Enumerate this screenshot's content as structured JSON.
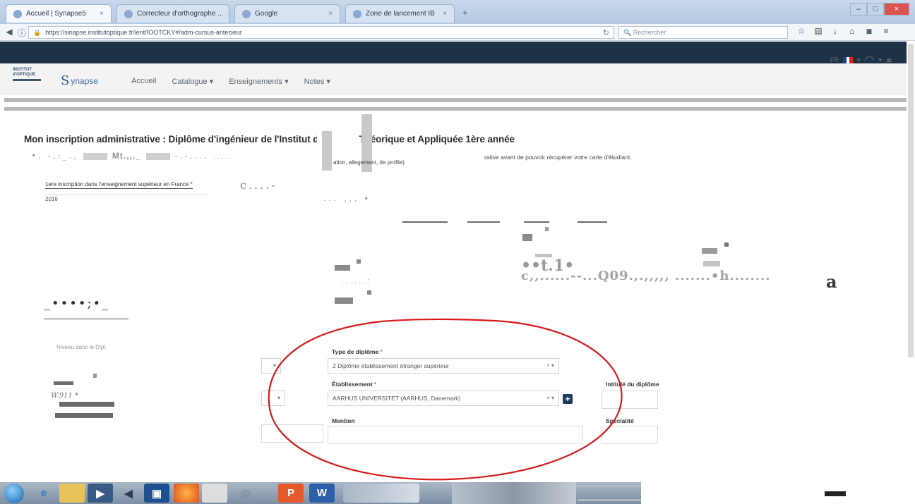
{
  "browser": {
    "tabs": [
      {
        "label": "Accueil | Synapse5"
      },
      {
        "label": "Correcteur d'orthographe ..."
      },
      {
        "label": "Google"
      },
      {
        "label": "Zone de lancement IB"
      }
    ],
    "new_tab_label": "+",
    "url": "https://sinapse.institutoptique.fr/ient/IOOTCKY#/adm-cursus-antecieur",
    "search_placeholder": "Rechercher",
    "toolbar_icons": [
      "star-icon",
      "bookmark-icon",
      "download-icon",
      "home-icon",
      "pocket-icon",
      "menu-icon"
    ]
  },
  "site": {
    "logo_text_1": "INSTITUT",
    "logo_text_2": "d'OPTIQUE",
    "logo_brand": "ynapse",
    "menu": [
      {
        "label": "Accueil"
      },
      {
        "label": "Catalogue ▾"
      },
      {
        "label": "Enseignements ▾"
      },
      {
        "label": "Notes ▾"
      }
    ],
    "lang_label": "FR"
  },
  "page": {
    "title": "Mon inscription administrative : Diplôme d'ingénieur de l'Institut d'Optique Théorique et Appliquée 1ère année",
    "subtitle_mid": "ation, allegement, de profile)",
    "subtitle_right": "rative avant de pouvoir récupérer votre carte d'étudiant.",
    "garble_1a": "•.  -.:_.,",
    "garble_1b": "Mt.,,._",
    "garble_1c": "-.-....",
    "garble_1d": ".....",
    "first_label": "1ere inscription dans l'enseignement supérieur en France *",
    "first_value": "2016",
    "garble_2": "c....-",
    "garble_3": "... ,,, ▪",
    "garble_t1": "••t.1•",
    "garble_q09": "c,,......--...Q09.,.,,,,, .......•h........",
    "garble_dots": "......:",
    "garble_a": "a",
    "garble_left": "_••••;•_",
    "left_caption": "Niveau dans le Dipl.",
    "garble_wm": "W.911   *"
  },
  "form": {
    "type_label": "Type de diplôme",
    "type_required": "*",
    "type_value": "2 Diplôme établissement étranger supérieur",
    "etab_label": "Établissement",
    "etab_required": "*",
    "etab_value": "AARHUS UNIVERSITET (AARHUS, Danemark)",
    "add_label": "+",
    "mention_label": "Mention",
    "intitule_label": "Intitulé du diplôme",
    "specialite_label": "Spécialité",
    "dropdown_arrow": "× ▾"
  },
  "colors": {
    "topbar": "#1e3247",
    "annotation": "#d81818",
    "accent": "#1c3d5e"
  }
}
